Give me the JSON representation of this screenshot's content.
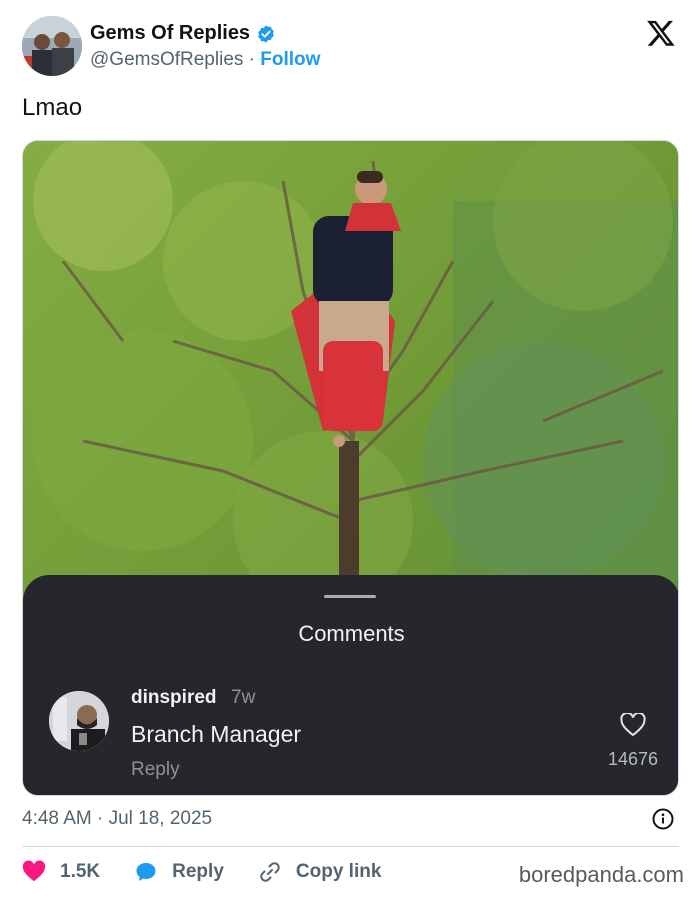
{
  "author": {
    "display_name": "Gems Of Replies",
    "handle": "@GemsOfReplies",
    "separator": " · ",
    "follow_label": "Follow",
    "verified": true
  },
  "tweet": {
    "text": "Lmao",
    "timestamp": "4:48 AM · Jul 18, 2025"
  },
  "media": {
    "description_icon": "photo-woman-standing-in-tree",
    "comments_sheet": {
      "title": "Comments",
      "comment": {
        "username": "dinspired",
        "age": "7w",
        "text": "Branch Manager",
        "reply_label": "Reply",
        "likes": "14676"
      }
    }
  },
  "actions": {
    "likes_count": "1.5K",
    "reply_label": "Reply",
    "copy_link_label": "Copy link"
  },
  "watermark": "boredpanda.com",
  "colors": {
    "accent": "#1d9bf0",
    "like_heart": "#f91880",
    "sheet_bg": "#25272c"
  }
}
